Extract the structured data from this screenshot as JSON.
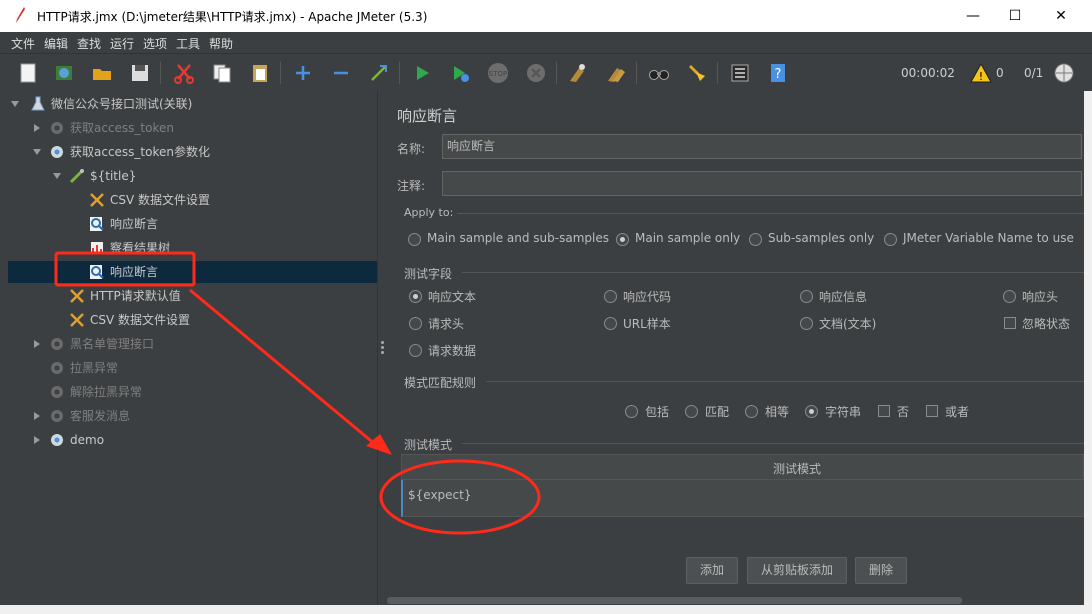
{
  "window": {
    "title": "HTTP请求.jmx (D:\\jmeter结果\\HTTP请求.jmx) - Apache JMeter (5.3)",
    "minimize": "—",
    "maximize": "☐",
    "close": "✕"
  },
  "menu": [
    "文件",
    "编辑",
    "查找",
    "运行",
    "选项",
    "工具",
    "帮助"
  ],
  "toolbar": {
    "timer": "00:00:02",
    "warnings": "0",
    "threads": "0/1"
  },
  "tree": {
    "root": "微信公众号接口测试(关联)",
    "items": [
      {
        "label": "获取access_token",
        "disabled": true
      },
      {
        "label": "获取access_token参数化",
        "disabled": false
      },
      {
        "label": "${title}",
        "disabled": false
      },
      {
        "label": "CSV 数据文件设置",
        "disabled": false
      },
      {
        "label": "响应断言",
        "disabled": false
      },
      {
        "label": "察看结果树",
        "disabled": false
      },
      {
        "label": "响应断言",
        "disabled": false
      },
      {
        "label": "HTTP请求默认值",
        "disabled": false
      },
      {
        "label": "CSV 数据文件设置",
        "disabled": false
      },
      {
        "label": "黑名单管理接口",
        "disabled": true
      },
      {
        "label": "拉黑异常",
        "disabled": true
      },
      {
        "label": "解除拉黑异常",
        "disabled": true
      },
      {
        "label": "客服发消息",
        "disabled": true
      },
      {
        "label": "demo",
        "disabled": false
      }
    ]
  },
  "panel": {
    "title": "响应断言",
    "name_label": "名称:",
    "name_value": "响应断言",
    "comment_label": "注释:",
    "comment_value": "",
    "apply_to": {
      "label": "Apply to:",
      "options": [
        "Main sample and sub-samples",
        "Main sample only",
        "Sub-samples only",
        "JMeter Variable Name to use"
      ],
      "selected": "Main sample only"
    },
    "field_to_test": {
      "label": "测试字段",
      "options": [
        "响应文本",
        "响应代码",
        "响应信息",
        "响应头",
        "请求头",
        "URL样本",
        "文档(文本)",
        "请求数据"
      ],
      "ignore_status": "忽略状态",
      "selected": "响应文本"
    },
    "pattern_rules": {
      "label": "模式匹配规则",
      "options": [
        "包括",
        "匹配",
        "相等",
        "字符串"
      ],
      "selected": "字符串",
      "not": "否",
      "or": "或者"
    },
    "patterns": {
      "label": "测试模式",
      "column_header": "测试模式",
      "rows": [
        "${expect}"
      ]
    },
    "buttons": {
      "add": "添加",
      "add_clipboard": "从剪贴板添加",
      "delete": "删除"
    }
  },
  "colors": {
    "background": "#3c3f41",
    "selection": "#0d293e",
    "annotation_red": "#ff2a1a"
  }
}
